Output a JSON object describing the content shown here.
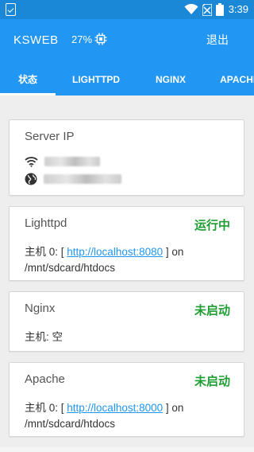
{
  "status_bar": {
    "time": "3:39",
    "icons": [
      "notification-check-icon",
      "wifi-icon",
      "no-sim-icon",
      "battery-icon"
    ]
  },
  "app_bar": {
    "title": "KSWEB",
    "cpu_usage": "27%",
    "cpu_icon": "cpu-chip-icon",
    "exit_label": "退出"
  },
  "tabs": [
    {
      "label": "状态",
      "selected": true
    },
    {
      "label": "LIGHTTPD",
      "selected": false
    },
    {
      "label": "NGINX",
      "selected": false
    },
    {
      "label": "APACHE",
      "selected": false
    }
  ],
  "server_ip": {
    "heading": "Server IP",
    "rows": [
      {
        "icon": "wifi-icon"
      },
      {
        "icon": "globe-icon"
      }
    ]
  },
  "lighttpd": {
    "name": "Lighttpd",
    "status": "运行中",
    "host_prefix": "主机 0: [",
    "host_link": "http://localhost:8080",
    "host_suffix": "] on /mnt/sdcard/htdocs"
  },
  "nginx": {
    "name": "Nginx",
    "status": "未启动",
    "host_text": "主机: 空"
  },
  "apache": {
    "name": "Apache",
    "status": "未启动",
    "host_prefix": "主机 0: [",
    "host_link": "http://localhost:8000",
    "host_suffix": "] on /mnt/sdcard/htdocs"
  },
  "colors": {
    "primary": "#2196f3",
    "status_bar": "#1a88d6",
    "running_green": "#1e9d32",
    "link": "#2196f3"
  }
}
